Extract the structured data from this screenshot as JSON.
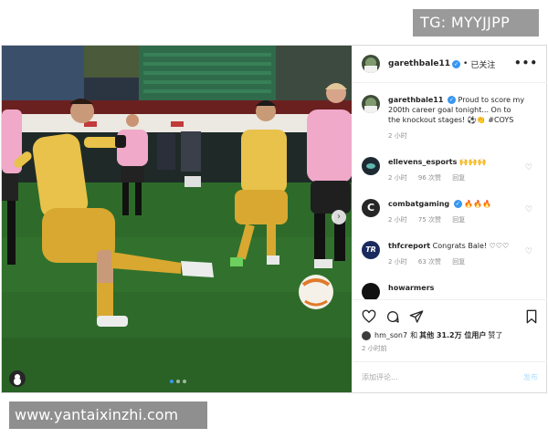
{
  "watermark_top": "TG: MYYJJPP",
  "watermark_bottom": "www.yantaixinzhi.com",
  "post": {
    "author": "garethbale11",
    "separator": "•",
    "follow_status": "已关注",
    "more_label": "•••",
    "carousel": {
      "count": 3,
      "active": 0
    },
    "caption": {
      "user": "garethbale11",
      "text": "Proud to score my 200th career goal tonight... On to the knockout stages! ⚽👏 #COYS",
      "time": "2 小时"
    },
    "comments": [
      {
        "user": "ellevens_esports",
        "text": "🙌🙌🙌",
        "time": "2 小时",
        "likes": "96 次赞",
        "reply": "回复"
      },
      {
        "user": "combatgaming",
        "text": "🔥🔥🔥",
        "time": "2 小时",
        "likes": "75 次赞",
        "reply": "回复"
      },
      {
        "user": "thfcreport",
        "text": "Congrats Bale! ♡♡♡",
        "time": "2 小时",
        "likes": "63 次赞",
        "reply": "回复"
      },
      {
        "user": "howarmers",
        "text": "",
        "time": "",
        "likes": "",
        "reply": ""
      }
    ],
    "likes_line": {
      "liker": "hm_son7",
      "and": "和",
      "others": "其他 31.2万 位用户",
      "suffix": "赞了"
    },
    "post_time": "2 小时前",
    "comment_placeholder": "添加评论...",
    "post_button": "发布"
  },
  "colors": {
    "verified": "#3897f0",
    "pitch": "#2d5a25",
    "kit_yellow": "#e8c24a",
    "kit_pink": "#f0a9c9",
    "post_button": "#b2dffc"
  },
  "icons": [
    "heart-icon",
    "comment-icon",
    "share-icon",
    "bookmark-icon",
    "more-icon",
    "verified-icon",
    "user-tag-icon",
    "chevron-right-icon"
  ]
}
